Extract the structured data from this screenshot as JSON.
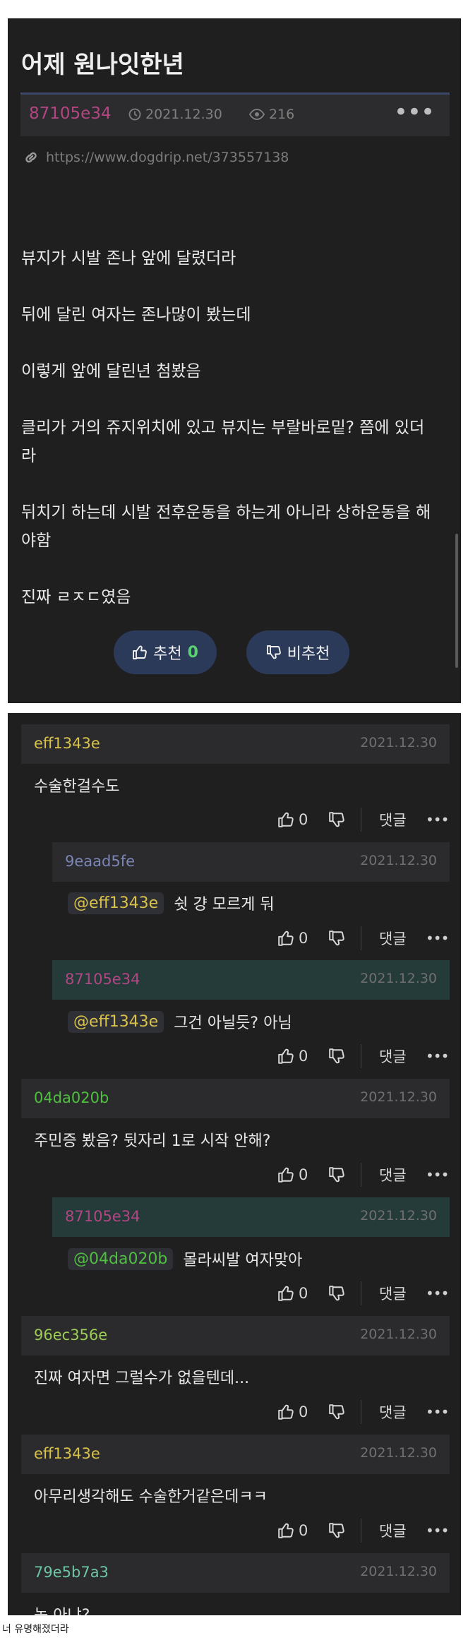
{
  "post": {
    "title": "어제 원나잇한년",
    "author": "87105e34",
    "author_color": "#b24682",
    "date": "2021.12.30",
    "views": "216",
    "more_label": "•••",
    "url": "https://www.dogdrip.net/373557138",
    "body": [
      "뷰지가 시발 존나 앞에 달렸더라",
      "뒤에 달린 여자는 존나많이 봤는데",
      "이렇게 앞에 달린년 첨봤음",
      "클리가 거의 쥬지위치에 있고 뷰지는 부랄바로밑? 쯤에 있더\n라",
      "뒤치기 하는데 시발 전후운동을 하는게 아니라 상하운동을 해\n야함",
      "진짜 ㄹㅈㄷ였음"
    ],
    "upvote_label": "추천",
    "upvote_count": "0",
    "downvote_label": "비추천"
  },
  "comments": [
    {
      "author": "eff1343e",
      "author_color": "#d8c24a",
      "date": "2021.12.30",
      "mention": "",
      "text": "수술한걸수도",
      "likes": "0",
      "reply_label": "댓글",
      "more": "•••"
    },
    {
      "author": "9eaad5fe",
      "author_color": "#7b86b6",
      "date": "2021.12.30",
      "mention": "@eff1343e",
      "text": "쉿 걍 모르게 둬",
      "likes": "0",
      "reply_label": "댓글",
      "more": "•••"
    },
    {
      "author": "87105e34",
      "author_color": "#b24682",
      "date": "2021.12.30",
      "mention": "@eff1343e",
      "text": "그건 아닐듯? 아님",
      "likes": "0",
      "reply_label": "댓글",
      "more": "•••"
    },
    {
      "author": "04da020b",
      "author_color": "#4fbf3f",
      "date": "2021.12.30",
      "mention": "",
      "text": "주민증 봤음? 뒷자리 1로 시작 안해?",
      "likes": "0",
      "reply_label": "댓글",
      "more": "•••"
    },
    {
      "author": "87105e34",
      "author_color": "#b24682",
      "date": "2021.12.30",
      "mention": "@04da020b",
      "text": "몰라씨발 여자맞아",
      "likes": "0",
      "reply_label": "댓글",
      "more": "•••"
    },
    {
      "author": "96ec356e",
      "author_color": "#9acd52",
      "date": "2021.12.30",
      "mention": "",
      "text": "진짜 여자면 그럴수가 없을텐데...",
      "likes": "0",
      "reply_label": "댓글",
      "more": "•••"
    },
    {
      "author": "eff1343e",
      "author_color": "#d8c24a",
      "date": "2021.12.30",
      "mention": "",
      "text": "아무리생각해도 수술한거같은데ㅋㅋ",
      "likes": "0",
      "reply_label": "댓글",
      "more": "•••"
    },
    {
      "author": "79e5b7a3",
      "author_color": "#6ec5a3",
      "date": "2021.12.30",
      "mention": "",
      "text": "놈 아냐?",
      "likes": "",
      "reply_label": "",
      "more": ""
    }
  ],
  "caption": "너 유명해졌더라"
}
